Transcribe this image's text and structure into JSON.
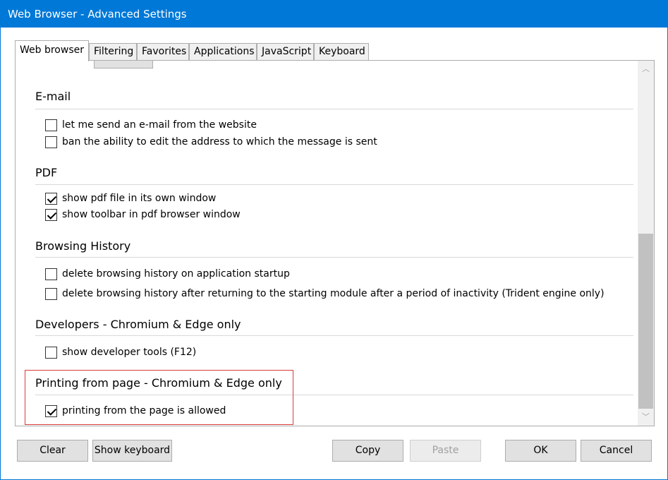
{
  "window": {
    "title": "Web Browser - Advanced Settings"
  },
  "tabs": [
    {
      "label": "Web browser",
      "active": true
    },
    {
      "label": "Filtering"
    },
    {
      "label": "Favorites"
    },
    {
      "label": "Applications"
    },
    {
      "label": "JavaScript"
    },
    {
      "label": "Keyboard"
    }
  ],
  "sections": {
    "email": {
      "title": "E-mail",
      "options": [
        {
          "label": "let me send an e-mail from the website",
          "checked": false
        },
        {
          "label": "ban the ability to edit the address to which the message is sent",
          "checked": false
        }
      ]
    },
    "pdf": {
      "title": "PDF",
      "options": [
        {
          "label": "show pdf file in its own window",
          "checked": true
        },
        {
          "label": "show toolbar in pdf browser window",
          "checked": true
        }
      ]
    },
    "history": {
      "title": "Browsing History",
      "options": [
        {
          "label": "delete browsing history on application startup",
          "checked": false
        },
        {
          "label": "delete browsing history after returning to the starting module after a period of inactivity (Trident engine only)",
          "checked": false
        }
      ]
    },
    "developers": {
      "title": "Developers - Chromium & Edge only",
      "options": [
        {
          "label": "show developer tools (F12)",
          "checked": false
        }
      ]
    },
    "printing": {
      "title": "Printing from page - Chromium & Edge only",
      "options": [
        {
          "label": "printing from the page is allowed",
          "checked": true
        }
      ]
    }
  },
  "scrollbar": {
    "up_icon": "chevron-up-icon",
    "down_icon": "chevron-down-icon",
    "up_glyph": "︿",
    "down_glyph": "﹀"
  },
  "buttons": {
    "clear": "Clear",
    "show_keyboard": "Show keyboard",
    "copy": "Copy",
    "paste": "Paste",
    "ok": "OK",
    "cancel": "Cancel"
  },
  "colors": {
    "titlebar": "#0078d7",
    "highlight": "#d93a3a"
  }
}
